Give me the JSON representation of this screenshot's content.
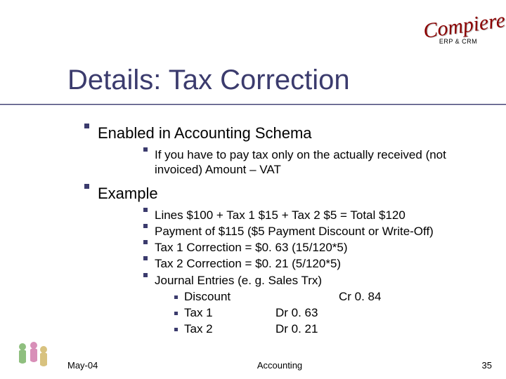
{
  "logo": {
    "word": "Compiere",
    "sub": "ERP & CRM"
  },
  "title": "Details: Tax Correction",
  "bullets": {
    "l1a": "Enabled in Accounting Schema",
    "l2a": "If you have to pay tax only on the actually received (not invoiced) Amount – VAT",
    "l1b": "Example",
    "ex1": "Lines $100 + Tax 1 $15 + Tax 2 $5 = Total $120",
    "ex2": "Payment of $115 ($5 Payment Discount or Write-Off)",
    "ex3": "Tax 1 Correction = $0. 63 (15/120*5)",
    "ex4": "Tax 2 Correction = $0. 21 (5/120*5)",
    "ex5": "Journal Entries (e. g. Sales Trx)",
    "j1": {
      "name": "Discount",
      "dr": "",
      "cr": "Cr 0. 84"
    },
    "j2": {
      "name": "Tax 1",
      "dr": "Dr 0. 63",
      "cr": ""
    },
    "j3": {
      "name": "Tax 2",
      "dr": "Dr 0. 21",
      "cr": ""
    }
  },
  "footer": {
    "left": "May-04",
    "center": "Accounting",
    "right": "35"
  }
}
